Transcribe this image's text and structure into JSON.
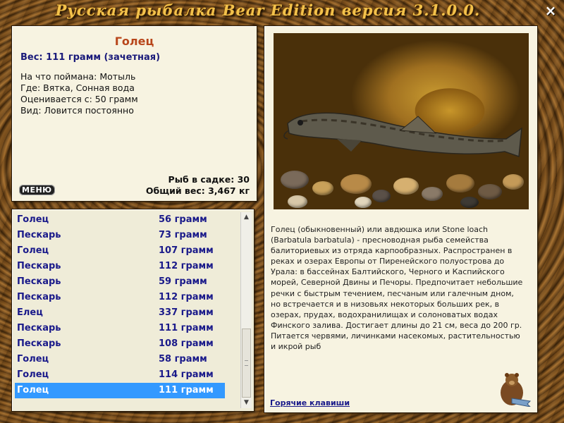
{
  "window": {
    "title": "Русская рыбалка   Bear Edition  версия  3.1.0.0.",
    "close_glyph": "×"
  },
  "info": {
    "fish_name": "Голец",
    "weight_line": "Вес: 111 грамм (зачетная)",
    "details": [
      "На что поймана: Мотыль",
      "Где: Вятка, Сонная вода",
      "Оценивается с: 50 грамм",
      "Вид: Ловится постоянно"
    ],
    "in_keepnet": "Рыб в садке: 30",
    "total_weight": "Общий вес: 3,467 кг",
    "menu_label": "МЕНЮ"
  },
  "catch_list": [
    {
      "name": "Голец",
      "weight": "56 грамм"
    },
    {
      "name": "Пескарь",
      "weight": "73 грамм"
    },
    {
      "name": "Голец",
      "weight": "107 грамм"
    },
    {
      "name": "Пескарь",
      "weight": "112 грамм"
    },
    {
      "name": "Пескарь",
      "weight": "59 грамм"
    },
    {
      "name": "Пескарь",
      "weight": "112 грамм"
    },
    {
      "name": "Елец",
      "weight": "337 грамм"
    },
    {
      "name": "Пескарь",
      "weight": "111 грамм"
    },
    {
      "name": "Пескарь",
      "weight": "108 грамм"
    },
    {
      "name": "Голец",
      "weight": "58 грамм"
    },
    {
      "name": "Голец",
      "weight": "114 грамм"
    },
    {
      "name": "Голец",
      "weight": "111 грамм",
      "selected": true
    }
  ],
  "description": "Голец (обыкновенный) или авдюшка или Stone loach (Barbatula barbatula) - пресноводная рыба семейства балиториевых из отряда карпообразных. Распространен в реках и озерах Европы от Пиренейского полуострова до Урала: в бассейнах Балтийского, Черного и Каспийского морей, Северной Двины и Печоры. Предпочитает небольшие речки с быстрым течением, песчаным или галечным дном, но встречается и в низовьях некоторых больших рек, в озерах, прудах, водохранилищах и солоноватых водах Финского залива. Достигает длины до 21 см, веса до 200 гр. Питается червями, личинками насекомых, растительностью и икрой рыб",
  "hotkeys_label": "Горячие клавиши",
  "colors": {
    "accent_title": "#f3c24b",
    "fish_name": "#b8461b",
    "list_text": "#1a1a8a",
    "selection": "#3399ff"
  }
}
